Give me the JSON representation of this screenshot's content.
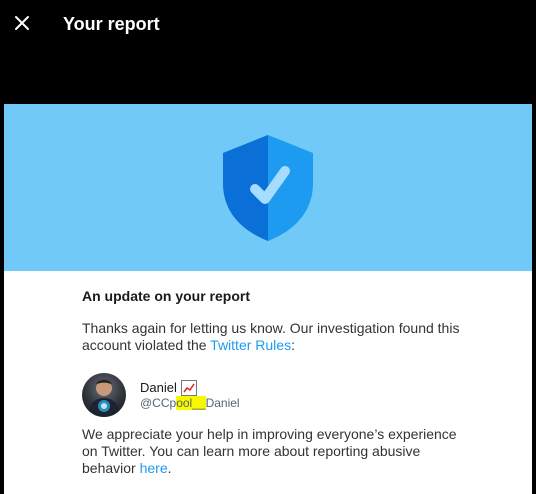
{
  "modal": {
    "title": "Your report",
    "close_icon": "close-icon"
  },
  "banner": {
    "icon": "shield-check-icon",
    "color": "#71c9f8"
  },
  "report": {
    "heading": "An update on your report",
    "para1_prefix": "Thanks again for letting us know. Our investigation found this account violated the ",
    "rules_link": "Twitter Rules",
    "para1_suffix": ":",
    "user": {
      "name": "Daniel",
      "emoji": "chart-increasing-icon",
      "handle_start": "@CCp",
      "handle_highlight": "ool__",
      "handle_end": "Daniel"
    },
    "para2_prefix": "We appreciate your help in improving everyone’s experience on Twitter. You can learn more about reporting abusive behavior ",
    "here_link": "here",
    "para2_suffix": "."
  }
}
